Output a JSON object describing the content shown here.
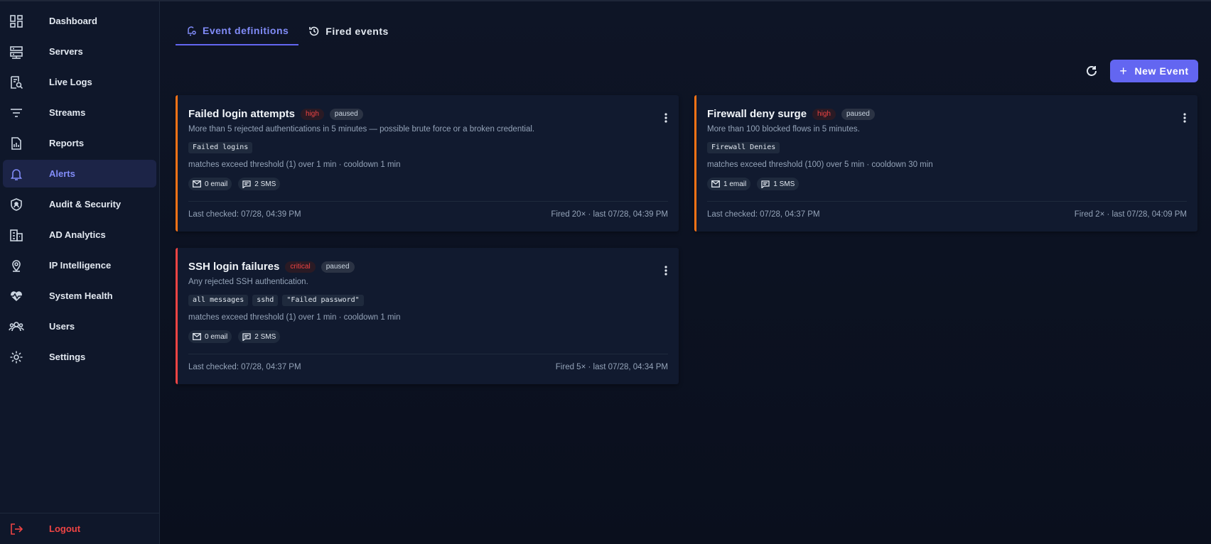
{
  "sidebar": {
    "items": [
      {
        "label": "Dashboard",
        "icon": "dashboard-icon"
      },
      {
        "label": "Servers",
        "icon": "servers-icon"
      },
      {
        "label": "Live Logs",
        "icon": "live-logs-icon"
      },
      {
        "label": "Streams",
        "icon": "streams-icon"
      },
      {
        "label": "Reports",
        "icon": "reports-icon"
      },
      {
        "label": "Alerts",
        "icon": "bell-icon",
        "active": true
      },
      {
        "label": "Audit & Security",
        "icon": "shield-icon"
      },
      {
        "label": "AD Analytics",
        "icon": "building-icon"
      },
      {
        "label": "IP Intelligence",
        "icon": "location-pin-icon"
      },
      {
        "label": "System Health",
        "icon": "heart-pulse-icon"
      },
      {
        "label": "Users",
        "icon": "users-icon"
      },
      {
        "label": "Settings",
        "icon": "gear-icon"
      }
    ],
    "logout": "Logout"
  },
  "tabs": {
    "definitions": "Event definitions",
    "fired": "Fired events"
  },
  "toolbar": {
    "new_event": "New Event"
  },
  "events": [
    {
      "title": "Failed login attempts",
      "severity": "high",
      "state": "paused",
      "description": "More than 5 rejected authentications in 5 minutes — possible brute force or a broken credential.",
      "chips": [
        "Failed logins"
      ],
      "rule": "matches exceed threshold (1) over 1 min · cooldown 1 min",
      "email": "0 email",
      "sms": "2 SMS",
      "last_checked": "Last checked: 07/28, 04:39 PM",
      "fired": "Fired 20× · last 07/28, 04:39 PM"
    },
    {
      "title": "Firewall deny surge",
      "severity": "high",
      "state": "paused",
      "description": "More than 100 blocked flows in 5 minutes.",
      "chips": [
        "Firewall Denies"
      ],
      "rule": "matches exceed threshold (100) over 5 min · cooldown 30 min",
      "email": "1 email",
      "sms": "1 SMS",
      "last_checked": "Last checked: 07/28, 04:37 PM",
      "fired": "Fired 2× · last 07/28, 04:09 PM"
    },
    {
      "title": "SSH login failures",
      "severity": "critical",
      "state": "paused",
      "description": "Any rejected SSH authentication.",
      "chips": [
        "all messages",
        "sshd",
        "\"Failed password\""
      ],
      "rule": "matches exceed threshold (1) over 1 min · cooldown 1 min",
      "email": "0 email",
      "sms": "2 SMS",
      "last_checked": "Last checked: 07/28, 04:37 PM",
      "fired": "Fired 5× · last 07/28, 04:34 PM"
    }
  ],
  "colors": {
    "accent": "#6366f1",
    "high": "#f97316",
    "critical": "#ef4444"
  }
}
